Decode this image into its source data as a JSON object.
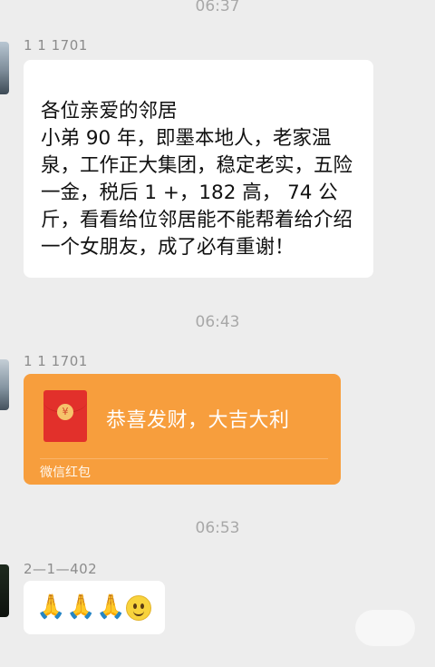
{
  "timestamps": [
    "06:37",
    "06:43",
    "06:53"
  ],
  "messages": [
    {
      "sender": "1 1 1701",
      "type": "text",
      "text": "各位亲爱的邻居\n小弟 90 年，即墨本地人，老家温泉，工作正大集团，稳定老实，五险一金，税后 1 +，182 高， 74 公斤，看看给位邻居能不能帮着给介绍一个女朋友，成了必有重谢！"
    },
    {
      "sender": "1 1 1701",
      "type": "red-packet",
      "title": "恭喜发财，大吉大利",
      "label": "微信红包",
      "color": "#f79e3d"
    },
    {
      "sender": "2—1—402",
      "type": "emoji",
      "emojis": [
        "🙏",
        "🙏",
        "🙏",
        "😊"
      ]
    }
  ]
}
